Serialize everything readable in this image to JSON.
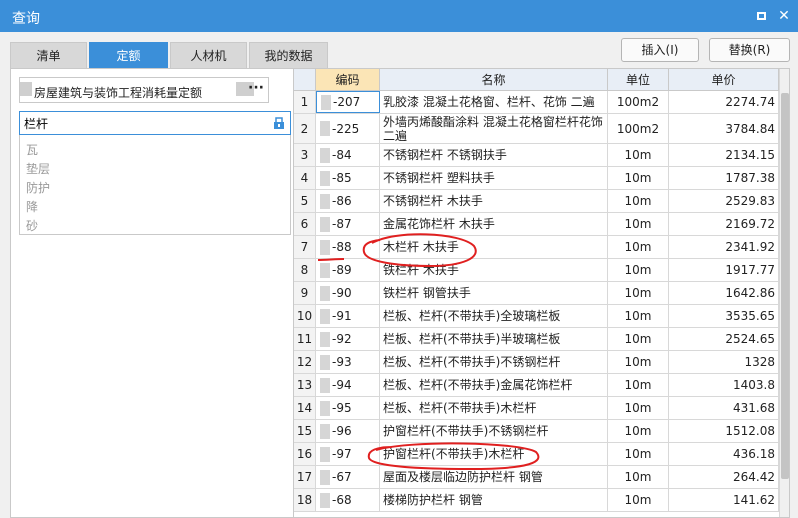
{
  "window": {
    "title": "查询",
    "restore_icon": "restore-icon",
    "close_icon": "close-icon"
  },
  "tabs": [
    {
      "label": "清单",
      "active": false
    },
    {
      "label": "定额",
      "active": true
    },
    {
      "label": "人材机",
      "active": false
    },
    {
      "label": "我的数据",
      "active": false
    }
  ],
  "actions": {
    "insert_label": "插入(I)",
    "replace_label": "替换(R)"
  },
  "left": {
    "quota_lib_text": "房屋建筑与装饰工程消耗量定额",
    "more_label": "···",
    "search_value": "栏杆",
    "search_icon": "search-icon",
    "suggestions": [
      "瓦",
      "垫层",
      "防护",
      "降",
      "砂"
    ]
  },
  "grid": {
    "headers": {
      "index": "",
      "code": "编码",
      "name": "名称",
      "unit": "单位",
      "price": "单价"
    },
    "rows": [
      {
        "idx": "1",
        "code": "-207",
        "name": "乳胶漆 混凝土花格窗、栏杆、花饰 二遍",
        "unit": "100m2",
        "price": "2274.74"
      },
      {
        "idx": "2",
        "code": "-225",
        "name": "外墙丙烯酸酯涂料 混凝土花格窗栏杆花饰 二遍",
        "unit": "100m2",
        "price": "3784.84"
      },
      {
        "idx": "3",
        "code": "-84",
        "name": "不锈钢栏杆 不锈钢扶手",
        "unit": "10m",
        "price": "2134.15"
      },
      {
        "idx": "4",
        "code": "-85",
        "name": "不锈钢栏杆 塑料扶手",
        "unit": "10m",
        "price": "1787.38"
      },
      {
        "idx": "5",
        "code": "-86",
        "name": "不锈钢栏杆 木扶手",
        "unit": "10m",
        "price": "2529.83"
      },
      {
        "idx": "6",
        "code": "-87",
        "name": "金属花饰栏杆 木扶手",
        "unit": "10m",
        "price": "2169.72"
      },
      {
        "idx": "7",
        "code": "-88",
        "name": "木栏杆 木扶手",
        "unit": "10m",
        "price": "2341.92"
      },
      {
        "idx": "8",
        "code": "-89",
        "name": "铁栏杆 木扶手",
        "unit": "10m",
        "price": "1917.77"
      },
      {
        "idx": "9",
        "code": "-90",
        "name": "铁栏杆 钢管扶手",
        "unit": "10m",
        "price": "1642.86"
      },
      {
        "idx": "10",
        "code": "-91",
        "name": "栏板、栏杆(不带扶手)全玻璃栏板",
        "unit": "10m",
        "price": "3535.65"
      },
      {
        "idx": "11",
        "code": "-92",
        "name": "栏板、栏杆(不带扶手)半玻璃栏板",
        "unit": "10m",
        "price": "2524.65"
      },
      {
        "idx": "12",
        "code": "-93",
        "name": "栏板、栏杆(不带扶手)不锈钢栏杆",
        "unit": "10m",
        "price": "1328"
      },
      {
        "idx": "13",
        "code": "-94",
        "name": "栏板、栏杆(不带扶手)金属花饰栏杆",
        "unit": "10m",
        "price": "1403.8"
      },
      {
        "idx": "14",
        "code": "-95",
        "name": "栏板、栏杆(不带扶手)木栏杆",
        "unit": "10m",
        "price": "431.68"
      },
      {
        "idx": "15",
        "code": "-96",
        "name": "护窗栏杆(不带扶手)不锈钢栏杆",
        "unit": "10m",
        "price": "1512.08"
      },
      {
        "idx": "16",
        "code": "-97",
        "name": "护窗栏杆(不带扶手)木栏杆",
        "unit": "10m",
        "price": "436.18"
      },
      {
        "idx": "17",
        "code": "-67",
        "name": "屋面及楼层临边防护栏杆 钢管",
        "unit": "10m",
        "price": "264.42"
      },
      {
        "idx": "18",
        "code": "-68",
        "name": "楼梯防护栏杆 钢管",
        "unit": "10m",
        "price": "141.62"
      }
    ]
  },
  "colors": {
    "accent": "#3b8fd9",
    "header_code_bg": "#fbe5b6",
    "annotation": "#e02020"
  }
}
